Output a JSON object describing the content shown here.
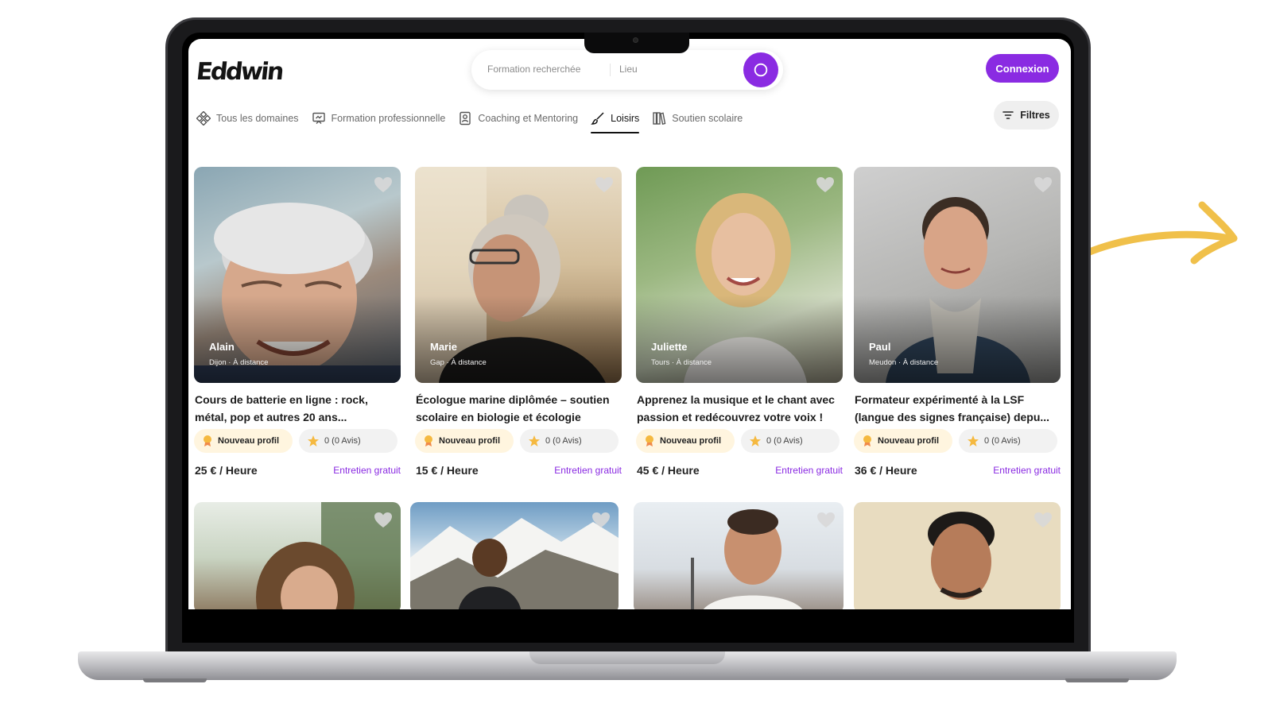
{
  "app": {
    "logo": "Eddwin"
  },
  "search": {
    "formation_placeholder": "Formation recherchée",
    "lieu_placeholder": "Lieu"
  },
  "header": {
    "login_label": "Connexion"
  },
  "tabs": [
    {
      "label": "Tous les domaines",
      "icon": "domains-icon",
      "active": false
    },
    {
      "label": "Formation professionnelle",
      "icon": "presentation-icon",
      "active": false
    },
    {
      "label": "Coaching et Mentoring",
      "icon": "badge-icon",
      "active": false
    },
    {
      "label": "Loisirs",
      "icon": "brush-icon",
      "active": true
    },
    {
      "label": "Soutien scolaire",
      "icon": "books-icon",
      "active": false
    }
  ],
  "filters": {
    "label": "Filtres"
  },
  "colors": {
    "accent": "#8a2be2",
    "arrow": "#f0c04a"
  },
  "cards": [
    {
      "name": "Alain",
      "location": "Dijon · À distance",
      "title_line1": "Cours de batterie en ligne : rock,",
      "title_line2": "métal, pop et autres 20 ans...",
      "badge_new": "Nouveau profil",
      "rating": "0 (0 Avis)",
      "price": "25 € / Heure",
      "cta": "Entretien gratuit"
    },
    {
      "name": "Marie",
      "location": "Gap · À distance",
      "title_line1": "Écologue marine diplômée – soutien",
      "title_line2": "scolaire en biologie et écologie",
      "badge_new": "Nouveau profil",
      "rating": "0 (0 Avis)",
      "price": "15 € / Heure",
      "cta": "Entretien gratuit"
    },
    {
      "name": "Juliette",
      "location": "Tours · À distance",
      "title_line1": "Apprenez la musique et le chant avec",
      "title_line2": "passion et redécouvrez votre voix !",
      "badge_new": "Nouveau profil",
      "rating": "0 (0 Avis)",
      "price": "45 € / Heure",
      "cta": "Entretien gratuit"
    },
    {
      "name": "Paul",
      "location": "Meudon · À distance",
      "title_line1": "Formateur expérimenté à la LSF",
      "title_line2": "(langue des signes française) depu...",
      "badge_new": "Nouveau profil",
      "rating": "0 (0 Avis)",
      "price": "36 € / Heure",
      "cta": "Entretien gratuit"
    }
  ]
}
